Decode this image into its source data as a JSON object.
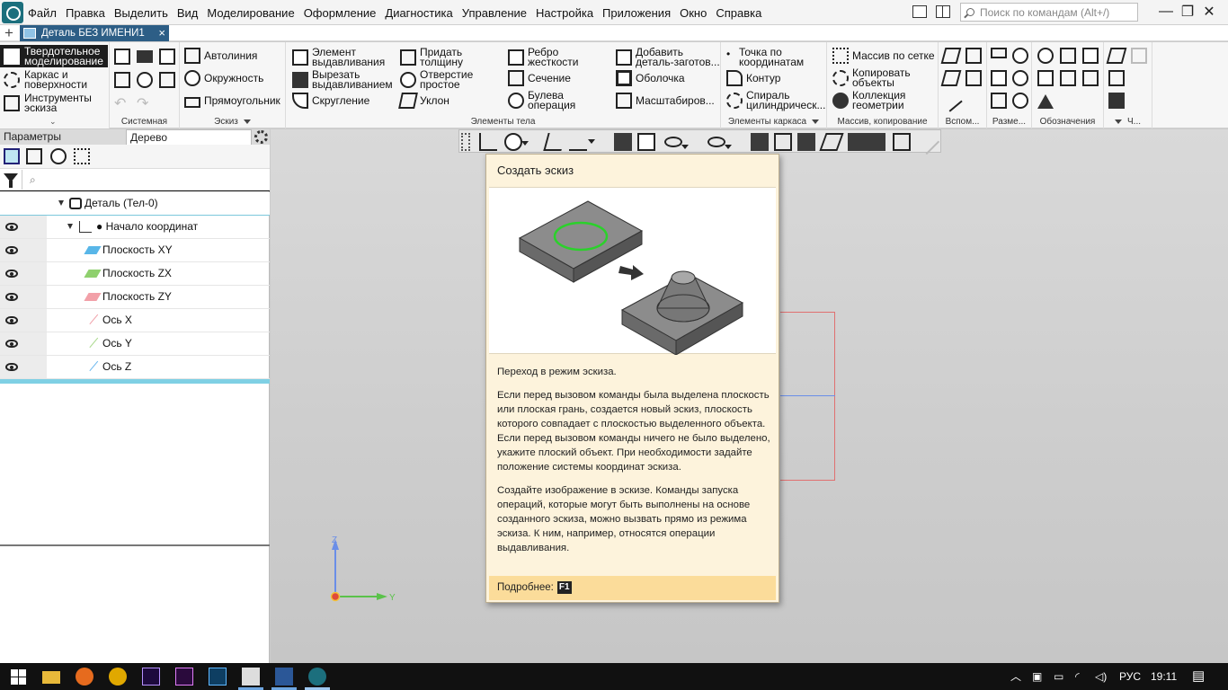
{
  "menu": {
    "items": [
      "Файл",
      "Правка",
      "Выделить",
      "Вид",
      "Моделирование",
      "Оформление",
      "Диагностика",
      "Управление",
      "Настройка",
      "Приложения",
      "Окно",
      "Справка"
    ],
    "search_placeholder": "Поиск по командам (Alt+/)"
  },
  "doc_tab": {
    "title": "Деталь БЕЗ ИМЕНИ1",
    "close": "×",
    "new": "+"
  },
  "ribbon": {
    "modes": [
      "Твердотельное\nмоделирование",
      "Каркас и\nповерхности",
      "Инструменты\nэскиза"
    ],
    "groups": {
      "system": "Системная",
      "sketch": "Эскиз",
      "elements": "Элементы тела",
      "frame": "Элементы каркаса",
      "array": "Массив, копирование",
      "aux": "Вспом...",
      "size": "Разме...",
      "notes": "Обозначения",
      "last": "Ч..."
    },
    "sketch_cmds": [
      "Автолиния",
      "Окружность",
      "Прямоугольник"
    ],
    "body_cmds_col1": [
      "Элемент\nвыдавливания",
      "Вырезать\nвыдавливанием",
      "Скругление"
    ],
    "body_cmds_col2": [
      "Придать\nтолщину",
      "Отверстие\nпростое",
      "Уклон"
    ],
    "body_cmds_col3": [
      "Ребро\nжесткости",
      "Сечение",
      "Булева\nоперация"
    ],
    "body_cmds_col4": [
      "Добавить\nдеталь-заготов...",
      "Оболочка",
      "Масштабиров..."
    ],
    "frame_cmds": [
      "Точка по\nкоординатам",
      "Контур",
      "Спираль\nцилиндрическ..."
    ],
    "array_cmds": [
      "Массив по сетке",
      "Копировать\nобъекты",
      "Коллекция\nгеометрии"
    ]
  },
  "panel": {
    "tabs": [
      "Параметры",
      "Дерево"
    ],
    "tree": [
      {
        "label": "Деталь (Тел-0)"
      },
      {
        "label": "Начало координат"
      },
      {
        "label": "Плоскость XY",
        "color": "#58b6e8"
      },
      {
        "label": "Плоскость ZX",
        "color": "#8fd06e"
      },
      {
        "label": "Плоскость ZY",
        "color": "#f2a0a8"
      },
      {
        "label": "Ось X",
        "color": "#f0a0a8"
      },
      {
        "label": "Ось Y",
        "color": "#a8d88a"
      },
      {
        "label": "Ось Z",
        "color": "#6cb7ee"
      }
    ]
  },
  "tooltip": {
    "title": "Создать эскиз",
    "p1": "Переход в режим эскиза.",
    "p2": "Если перед вызовом команды была выделена плоскость или плоская грань, создается новый эскиз, плоскость которого совпадает с плоскостью выделенного объекта. Если перед вызовом команды ничего не было выделено, укажите плоский объект. При необходимости задайте положение системы координат эскиза.",
    "p3": "Создайте изображение в эскизе. Команды запуска операций, которые могут быть выполнены на основе созданного эскиза, можно вызвать прямо из режима эскиза. К ним, например, относятся операции выдавливания.",
    "more": "Подробнее:",
    "key": "F1"
  },
  "triad": {
    "z": "Z",
    "y": "Y"
  },
  "taskbar": {
    "lang": "РУС",
    "time": "19:11"
  },
  "colors": {
    "accent": "#2d5e86",
    "selected_mode": "#1d1d1d",
    "tooltip_bg": "#fdf3dc",
    "tooltip_footer": "#fbdc9a"
  }
}
